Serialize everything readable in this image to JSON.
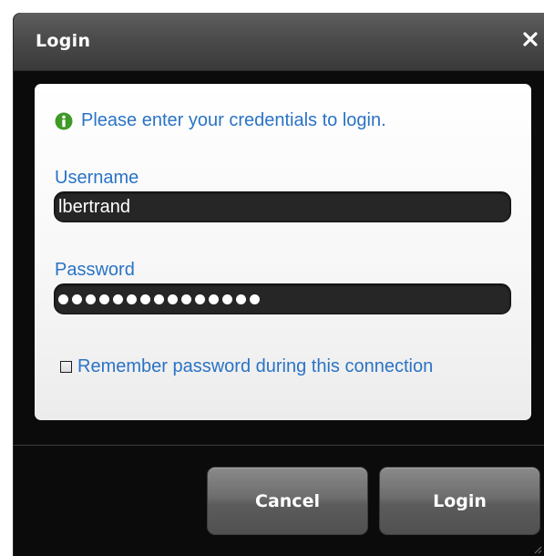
{
  "dialog": {
    "title": "Login",
    "close_icon": "close-icon"
  },
  "form": {
    "info_icon": "info-icon",
    "info_text": "Please enter your credentials to login.",
    "username_label": "Username",
    "username_value": "lbertrand",
    "password_label": "Password",
    "password_masked_length": 15,
    "remember_label": "Remember password during this connection",
    "remember_checked": false
  },
  "buttons": {
    "cancel_label": "Cancel",
    "login_label": "Login"
  },
  "colors": {
    "accent_text": "#2a73c5",
    "info_icon": "#3f9a28",
    "dialog_bg": "#0b0b0b",
    "field_bg": "#262626"
  }
}
